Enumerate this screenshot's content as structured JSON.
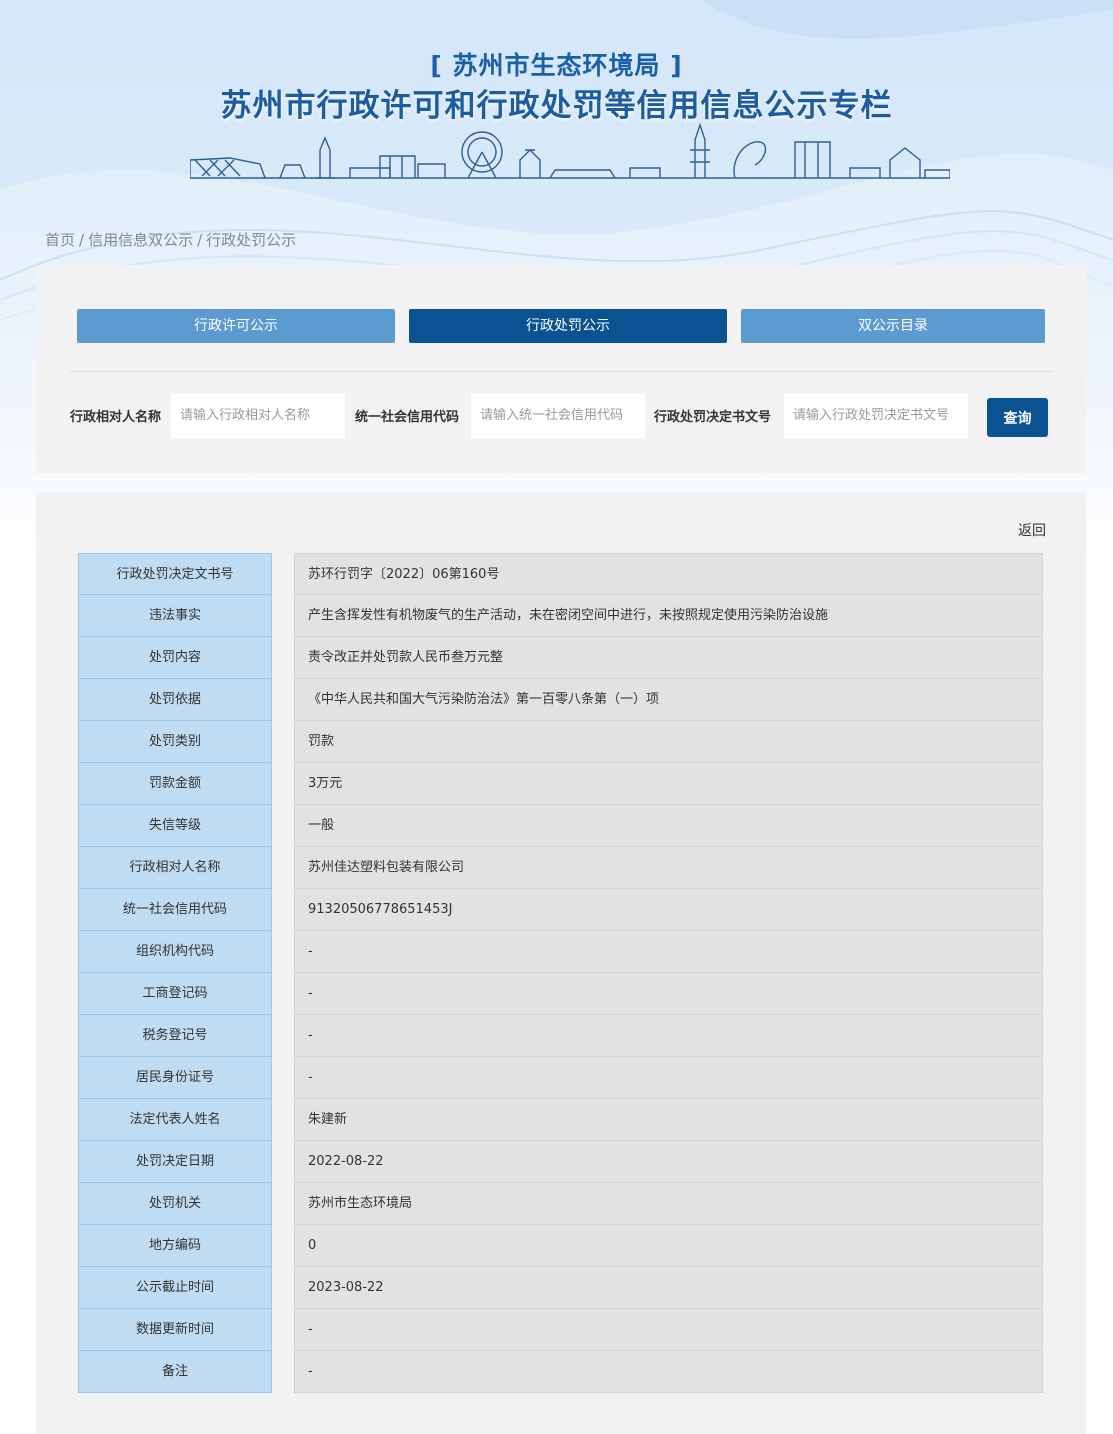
{
  "header": {
    "agency": "[ 苏州市生态环境局 ]",
    "title": "苏州市行政许可和行政处罚等信用信息公示专栏"
  },
  "breadcrumb": [
    "首页",
    "信用信息双公示",
    "行政处罚公示"
  ],
  "tabs": [
    {
      "label": "行政许可公示",
      "active": false
    },
    {
      "label": "行政处罚公示",
      "active": true
    },
    {
      "label": "双公示目录",
      "active": false
    }
  ],
  "search": {
    "name_label": "行政相对人名称",
    "name_placeholder": "请输入行政相对人名称",
    "code_label": "统一社会信用代码",
    "code_placeholder": "请输入统一社会信用代码",
    "doc_label": "行政处罚决定书文号",
    "doc_placeholder": "请输入行政处罚决定书文号",
    "button": "查询"
  },
  "back_label": "返回",
  "details": [
    {
      "label": "行政处罚决定文书号",
      "value": "苏环行罚字〔2022〕06第160号"
    },
    {
      "label": "违法事实",
      "value": "产生含挥发性有机物废气的生产活动，未在密闭空间中进行，未按照规定使用污染防治设施"
    },
    {
      "label": "处罚内容",
      "value": "责令改正并处罚款人民币叁万元整"
    },
    {
      "label": "处罚依据",
      "value": "《中华人民共和国大气污染防治法》第一百零八条第（一）项"
    },
    {
      "label": "处罚类别",
      "value": "罚款"
    },
    {
      "label": "罚款金额",
      "value": "3万元"
    },
    {
      "label": "失信等级",
      "value": "一般"
    },
    {
      "label": "行政相对人名称",
      "value": "苏州佳达塑料包装有限公司"
    },
    {
      "label": "统一社会信用代码",
      "value": "91320506778651453J"
    },
    {
      "label": "组织机构代码",
      "value": "-"
    },
    {
      "label": "工商登记码",
      "value": "-"
    },
    {
      "label": "税务登记号",
      "value": "-"
    },
    {
      "label": "居民身份证号",
      "value": "-"
    },
    {
      "label": "法定代表人姓名",
      "value": "朱建新"
    },
    {
      "label": "处罚决定日期",
      "value": "2022-08-22"
    },
    {
      "label": "处罚机关",
      "value": "苏州市生态环境局"
    },
    {
      "label": "地方编码",
      "value": "0"
    },
    {
      "label": "公示截止时间",
      "value": "2023-08-22"
    },
    {
      "label": "数据更新时间",
      "value": "-"
    },
    {
      "label": "备注",
      "value": "-"
    }
  ],
  "colors": {
    "accent_dark": "#0a5291",
    "accent_light": "#5b9bd0",
    "label_bg": "#bfdcf3",
    "value_bg": "#e2e2e2"
  }
}
